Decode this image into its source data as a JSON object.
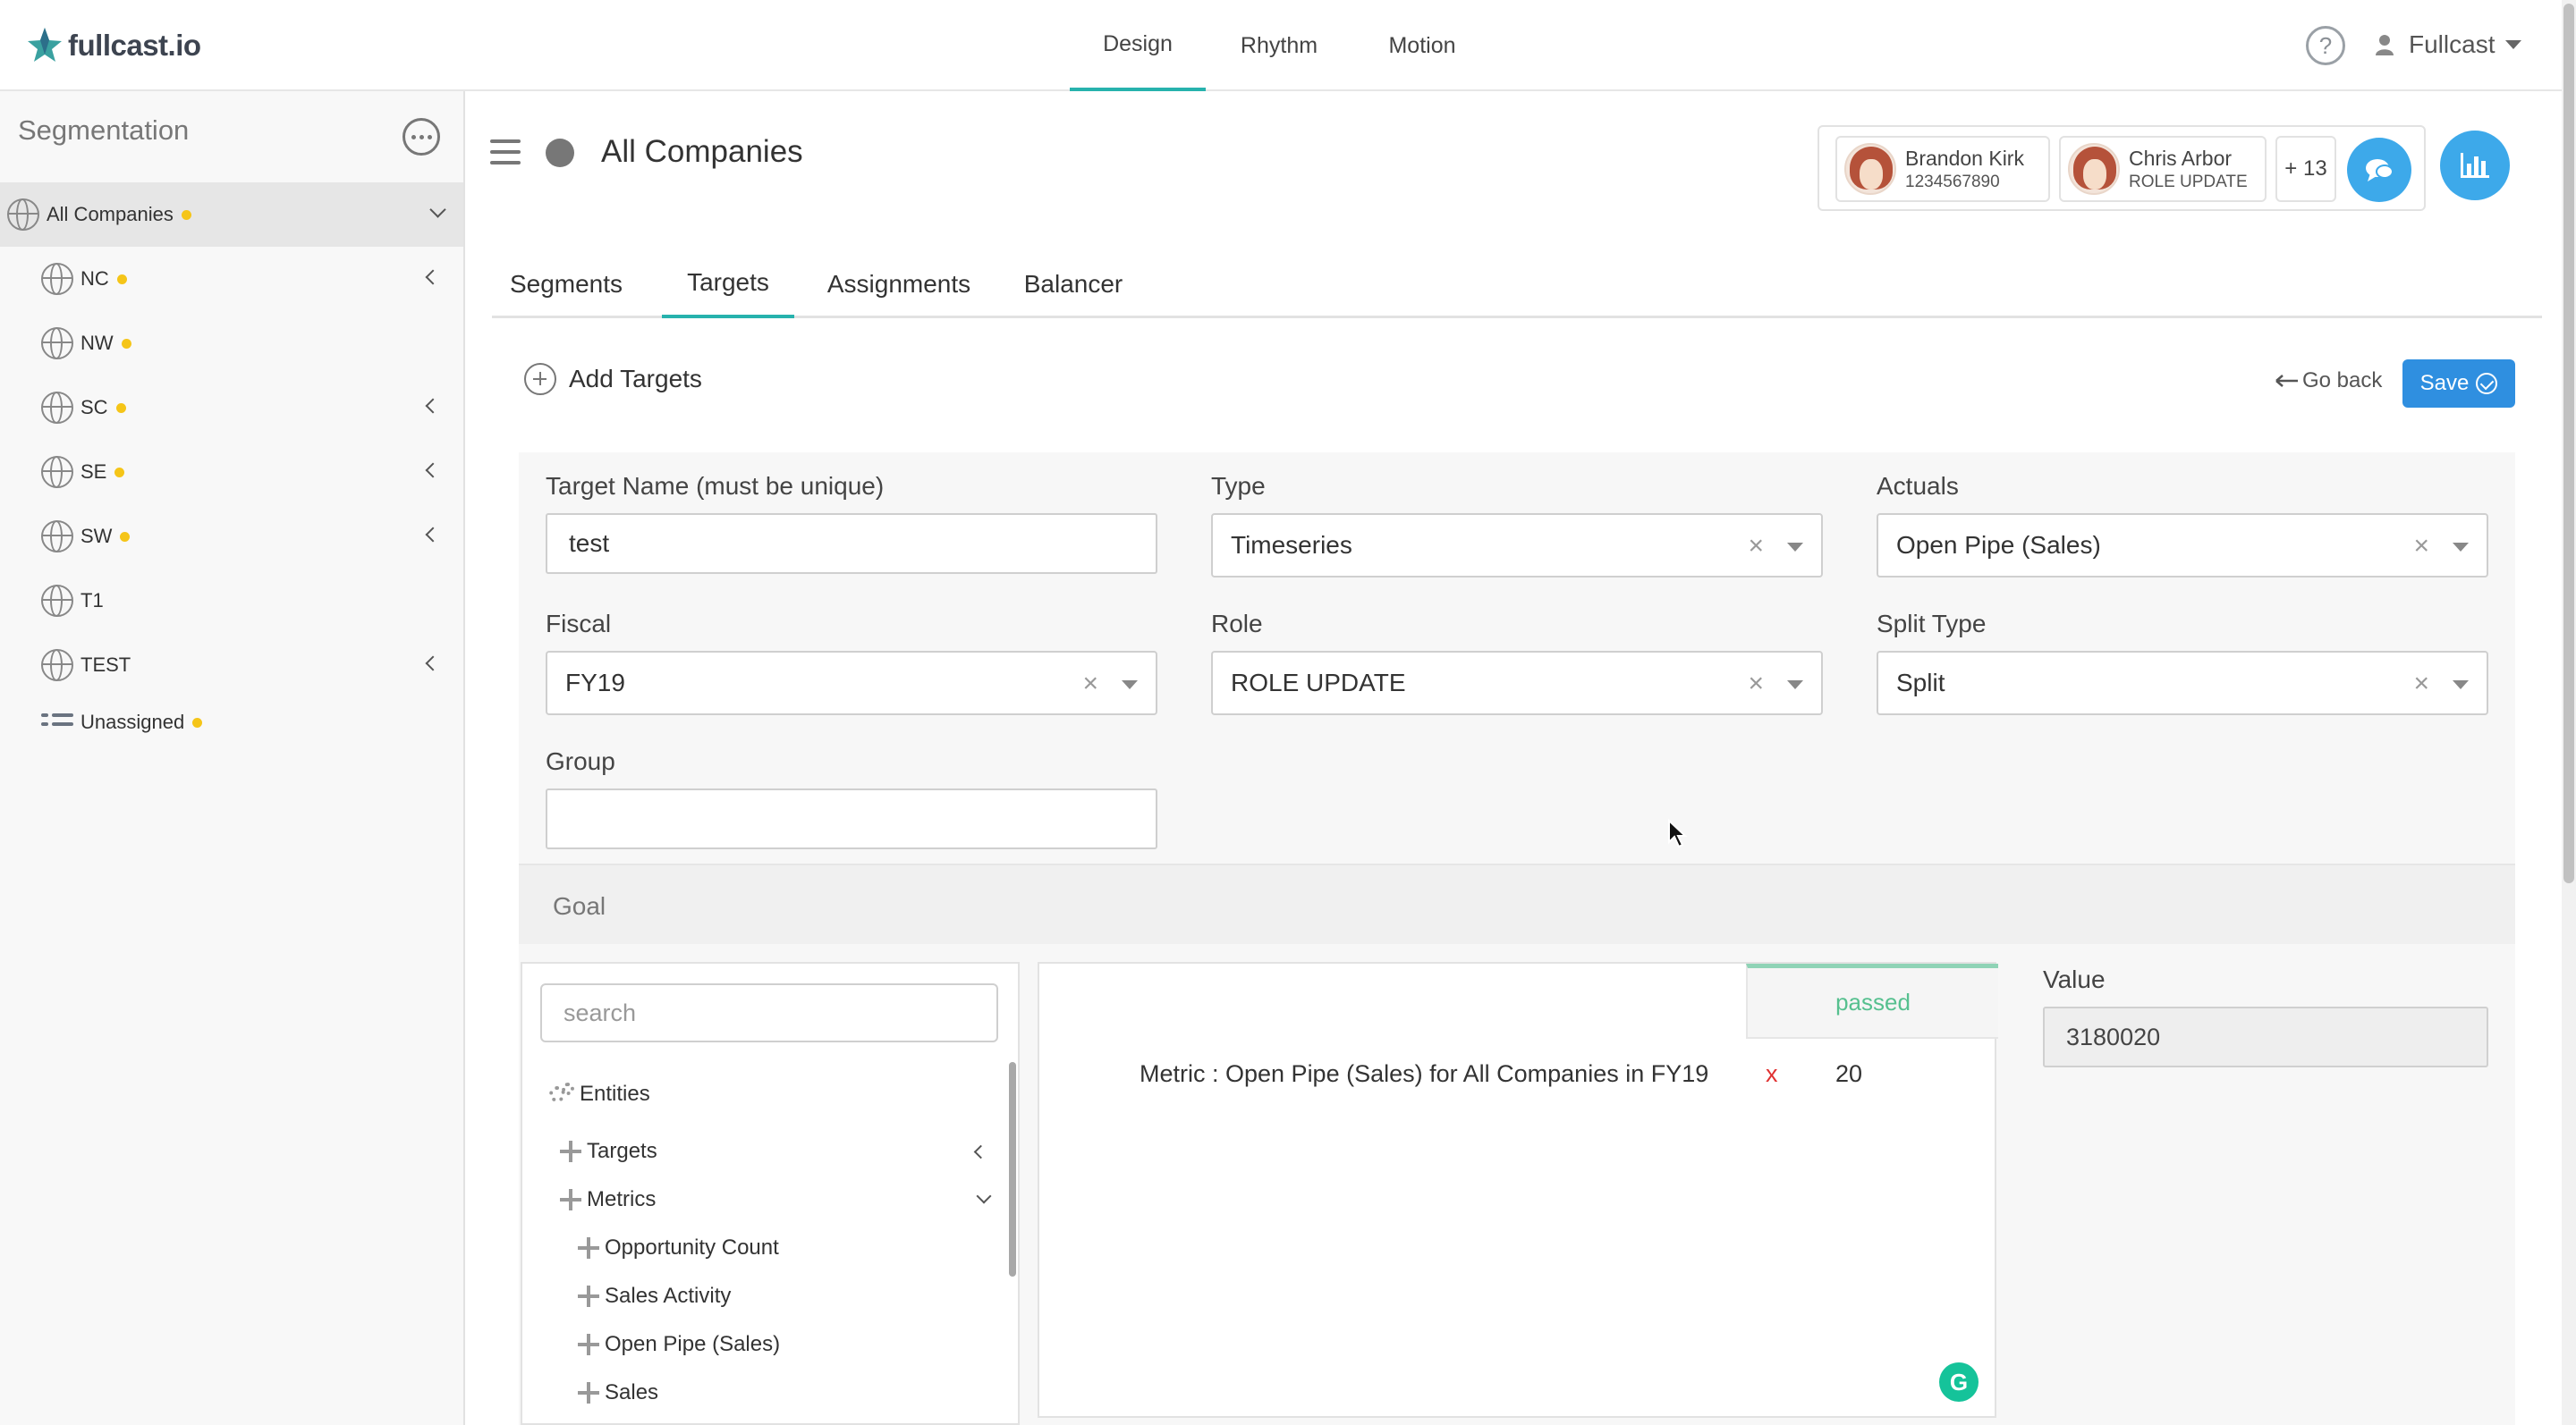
{
  "app": {
    "logo_text": "fullcast.io"
  },
  "topnav": {
    "tabs": [
      {
        "label": "Design",
        "active": true
      },
      {
        "label": "Rhythm",
        "active": false
      },
      {
        "label": "Motion",
        "active": false
      }
    ],
    "help_label": "?",
    "user_name": "Fullcast"
  },
  "sidebar": {
    "title": "Segmentation",
    "items": [
      {
        "label": "All Companies",
        "icon": "globe-icon",
        "status_dot": true,
        "expander": "chevron-down",
        "selected": true
      },
      {
        "label": "NC",
        "icon": "globe-icon",
        "status_dot": true,
        "expander": "chevron-left"
      },
      {
        "label": "NW",
        "icon": "globe-icon",
        "status_dot": true,
        "expander": null
      },
      {
        "label": "SC",
        "icon": "globe-icon",
        "status_dot": true,
        "expander": "chevron-left"
      },
      {
        "label": "SE",
        "icon": "globe-icon",
        "status_dot": true,
        "expander": "chevron-left"
      },
      {
        "label": "SW",
        "icon": "globe-icon",
        "status_dot": true,
        "expander": "chevron-left"
      },
      {
        "label": "T1",
        "icon": "globe-icon",
        "status_dot": false,
        "expander": null
      },
      {
        "label": "TEST",
        "icon": "globe-icon",
        "status_dot": false,
        "expander": "chevron-left"
      },
      {
        "label": "Unassigned",
        "icon": "list-icon",
        "status_dot": true,
        "expander": null
      }
    ]
  },
  "header": {
    "title": "All Companies",
    "collaborators": [
      {
        "name": "Brandon Kirk",
        "subtitle": "1234567890"
      },
      {
        "name": "Chris Arbor",
        "subtitle": "ROLE UPDATE"
      }
    ],
    "more_count": "+ 13"
  },
  "subtabs": [
    {
      "label": "Segments",
      "active": false
    },
    {
      "label": "Targets",
      "active": true
    },
    {
      "label": "Assignments",
      "active": false
    },
    {
      "label": "Balancer",
      "active": false
    }
  ],
  "form": {
    "add_targets_label": "Add Targets",
    "go_back_label": "Go back",
    "save_label": "Save",
    "target_name": {
      "label": "Target Name (must be unique)",
      "value": "test"
    },
    "type": {
      "label": "Type",
      "value": "Timeseries"
    },
    "actuals": {
      "label": "Actuals",
      "value": "Open Pipe (Sales)"
    },
    "fiscal": {
      "label": "Fiscal",
      "value": "FY19"
    },
    "role": {
      "label": "Role",
      "value": "ROLE UPDATE"
    },
    "split_type": {
      "label": "Split Type",
      "value": "Split"
    },
    "group": {
      "label": "Group",
      "value": ""
    }
  },
  "goal": {
    "title": "Goal",
    "search_placeholder": "search",
    "tree": {
      "root": "Entities",
      "nodes": [
        {
          "label": "Targets",
          "level": 1,
          "expander": "chevron-left"
        },
        {
          "label": "Metrics",
          "level": 1,
          "expander": "chevron-down"
        },
        {
          "label": "Opportunity Count",
          "level": 2
        },
        {
          "label": "Sales Activity",
          "level": 2
        },
        {
          "label": "Open Pipe (Sales)",
          "level": 2
        },
        {
          "label": "Sales",
          "level": 2
        }
      ]
    },
    "status_header": "passed",
    "metric_text": "Metric : Open Pipe (Sales) for All Companies in FY19",
    "remove_label": "x",
    "metric_value": "20",
    "value_label": "Value",
    "value": "3180020"
  },
  "colors": {
    "accent": "#27b2ad",
    "primary_button": "#2f8fe0",
    "status_dot": "#f5c518",
    "passed": "#56c08f",
    "remove": "#e03131"
  }
}
